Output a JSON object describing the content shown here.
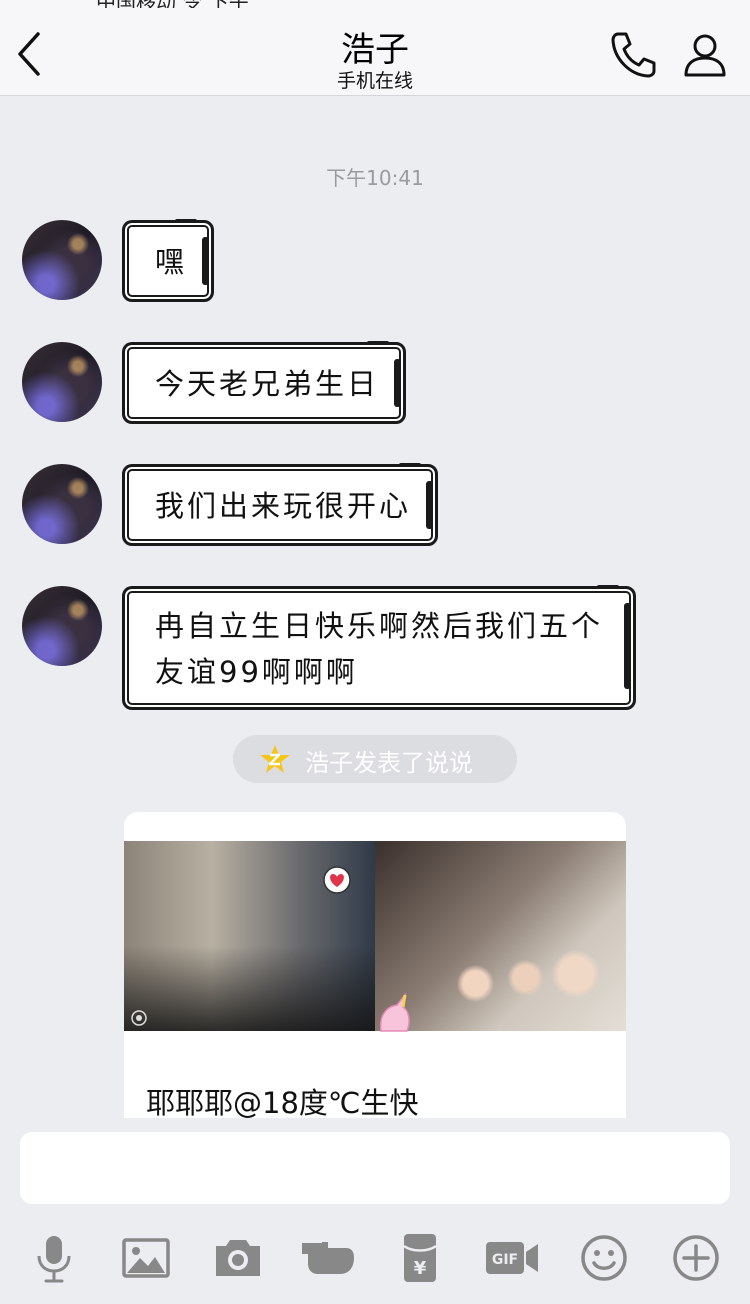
{
  "header": {
    "contact_name": "浩子",
    "status": "手机在线",
    "status_bar_fragment": "中国移动 令 下午"
  },
  "chat": {
    "timestamp": "下午10:41",
    "messages": [
      {
        "text": "嘿"
      },
      {
        "text": "今天老兄弟生日"
      },
      {
        "text": "我们出来玩很开心"
      },
      {
        "text": "冉自立生日快乐啊然后我们五个\n友谊99啊啊啊"
      }
    ],
    "notice": "浩子发表了说说",
    "post_caption": "耶耶耶@18度℃生快"
  },
  "input": {
    "placeholder": ""
  },
  "toolbar": {
    "items": [
      "voice-icon",
      "image-icon",
      "camera-icon",
      "poke-icon",
      "red-packet-icon",
      "gif-icon",
      "emoji-icon",
      "plus-icon"
    ]
  },
  "colors": {
    "background": "#ecedf1",
    "header_bg": "#f7f7f9",
    "icon_gray": "#888888",
    "notice_star": "#f5c518"
  }
}
